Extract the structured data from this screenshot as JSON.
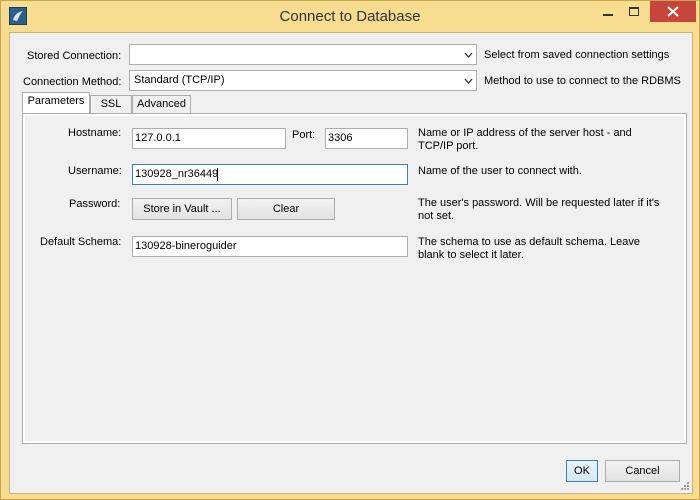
{
  "window": {
    "title": "Connect to Database"
  },
  "top_fields": {
    "stored_connection": {
      "label": "Stored Connection:",
      "value": "",
      "hint": "Select from saved connection settings"
    },
    "connection_method": {
      "label": "Connection Method:",
      "value": "Standard (TCP/IP)",
      "hint": "Method to use to connect to the RDBMS"
    }
  },
  "tabs": [
    {
      "label": "Parameters",
      "active": true
    },
    {
      "label": "SSL",
      "active": false
    },
    {
      "label": "Advanced",
      "active": false
    }
  ],
  "parameters": {
    "hostname": {
      "label": "Hostname:",
      "value": "127.0.0.1"
    },
    "port": {
      "label": "Port:",
      "value": "3306"
    },
    "host_hint": {
      "line1": "Name or IP address of the server host - and",
      "line2": "TCP/IP port."
    },
    "username": {
      "label": "Username:",
      "value": "130928_nr36449",
      "hint": "Name of the user to connect with."
    },
    "password": {
      "label": "Password:",
      "store_button": "Store in Vault ...",
      "clear_button": "Clear",
      "hint_line1": "The user's password. Will be requested later if it's",
      "hint_line2": "not set."
    },
    "default_schema": {
      "label": "Default Schema:",
      "value": "130928-bineroguider",
      "hint_line1": "The schema to use as default schema. Leave",
      "hint_line2": "blank to select it later."
    }
  },
  "footer": {
    "ok_label": "OK",
    "cancel_label": "Cancel"
  },
  "colors": {
    "title_bar": "#f8dc8f",
    "close_button": "#c7463b",
    "focus_border": "#3c7fb1"
  }
}
